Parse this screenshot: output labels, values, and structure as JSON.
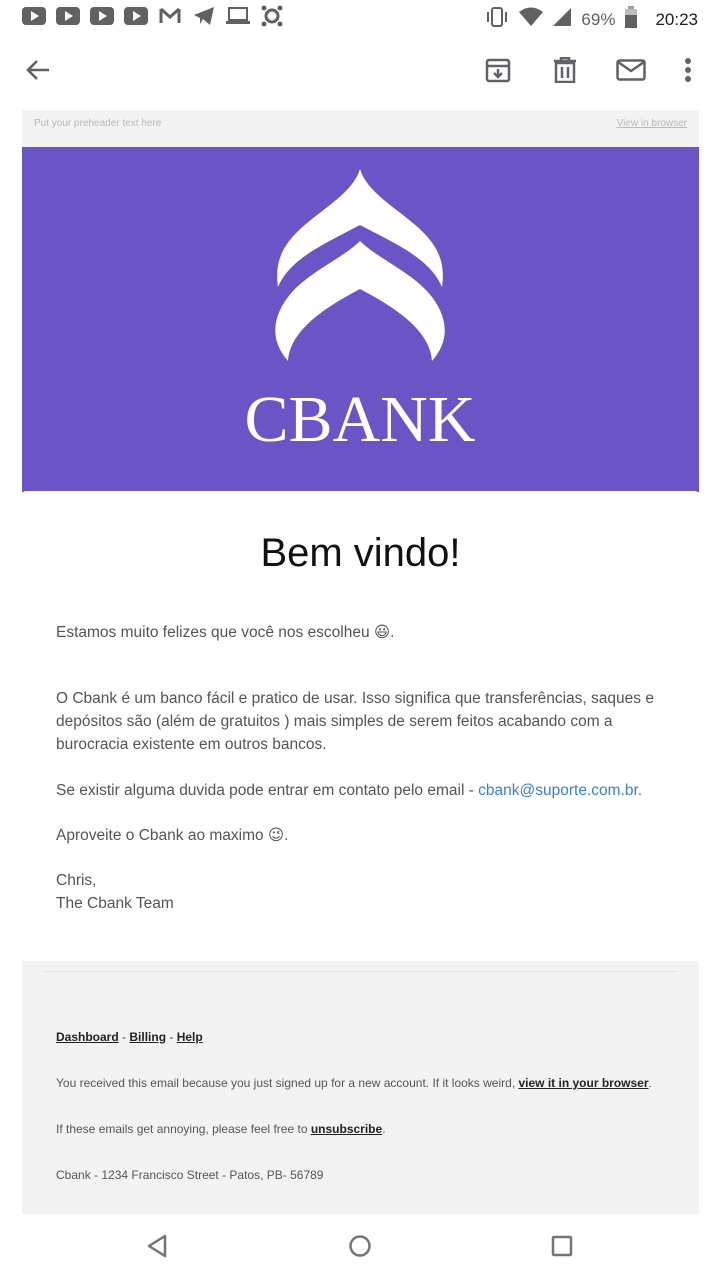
{
  "status_bar": {
    "notification_icons": [
      "youtube-icon",
      "youtube-icon",
      "youtube-icon",
      "youtube-icon",
      "gmail-icon",
      "telegram-icon",
      "laptop-icon",
      "app-icon"
    ],
    "battery": "69%",
    "time": "20:23"
  },
  "toolbar": {
    "back": "back-arrow-icon",
    "archive": "archive-icon",
    "delete": "trash-icon",
    "mark_unread": "mail-icon",
    "more": "more-vert-icon"
  },
  "email": {
    "preheader": "Put your preheader text here",
    "view_in_browser": "View in browser",
    "brand": "CBANK",
    "heading": "Bem vindo!",
    "intro": "Estamos muito felizes que você nos escolheu 😃.",
    "body1": "O Cbank é um banco fácil e pratico de usar. Isso significa que transferências, saques e depósitos são (além de gratuitos ) mais simples de serem feitos acabando com a burocracia existente em outros bancos.",
    "contact_prefix": "Se existir alguma duvida pode entrar em contato pelo email - ",
    "contact_email": "cbank@suporte.com.br.",
    "enjoy": "Aproveite o Cbank ao maximo 😉.",
    "sign_name": "Chris,",
    "sign_team": "The Cbank Team"
  },
  "footer": {
    "dashboard": "Dashboard",
    "billing": "Billing",
    "help": "Help",
    "sep": " - ",
    "received_prefix": "You received this email because you just signed up for a new account. If it looks weird, ",
    "view_browser_link": "view it in your browser",
    "period": ".",
    "annoying_prefix": "If these emails get annoying, please feel free to ",
    "unsubscribe": "unsubscribe",
    "address": "Cbank - 1234 Francisco  Street - Patos, PB- 56789"
  },
  "colors": {
    "brand_purple": "#6b55c6",
    "link_blue": "#3b7fd6"
  }
}
